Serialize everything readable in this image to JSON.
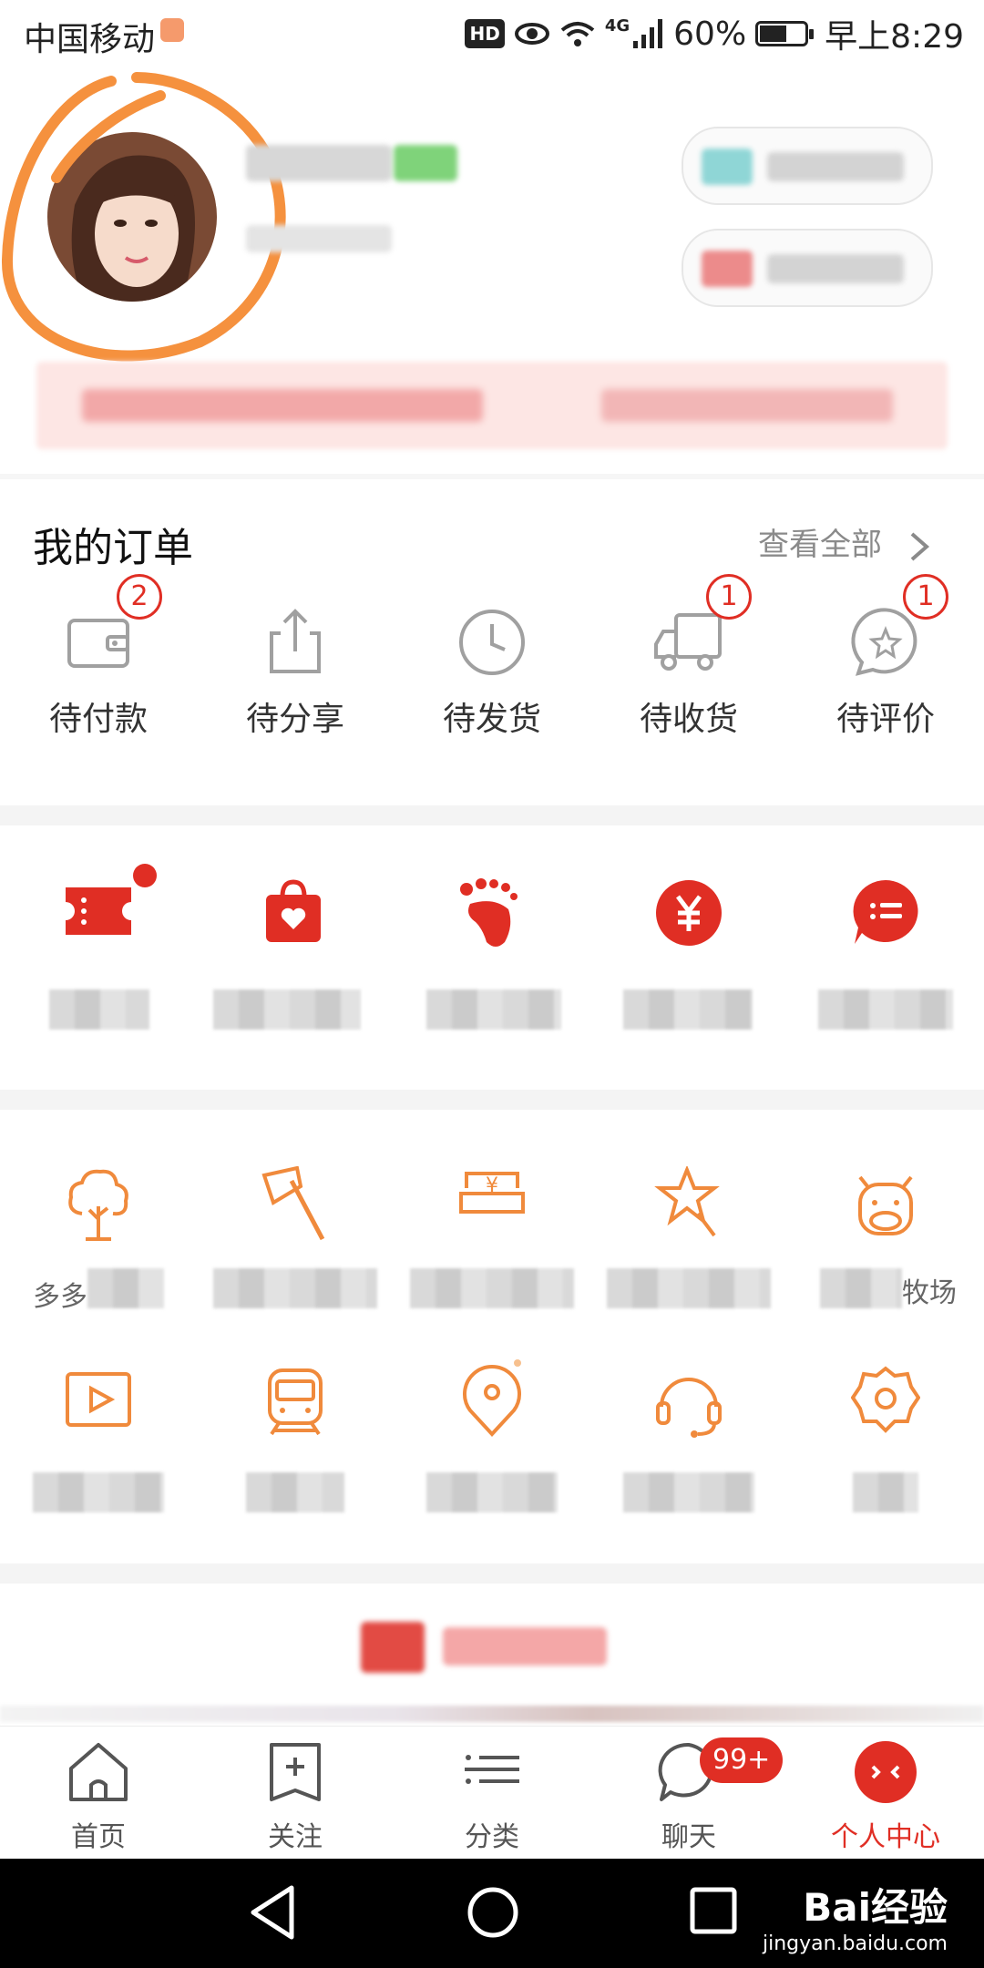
{
  "status_bar": {
    "carrier": "中国移动",
    "network": "4G",
    "hd_label": "HD",
    "battery": "60%",
    "time": "早上8:29"
  },
  "orders": {
    "title": "我的订单",
    "see_all": "查看全部",
    "items": [
      {
        "label": "待付款",
        "icon": "wallet-icon",
        "badge": "2"
      },
      {
        "label": "待分享",
        "icon": "share-icon",
        "badge": ""
      },
      {
        "label": "待发货",
        "icon": "clock-icon",
        "badge": ""
      },
      {
        "label": "待收货",
        "icon": "truck-icon",
        "badge": "1"
      },
      {
        "label": "待评价",
        "icon": "review-star-icon",
        "badge": "1"
      }
    ]
  },
  "services_row1": {
    "icons": [
      "coupon-icon",
      "favorites-bag-icon",
      "footprint-icon",
      "wallet-yuan-icon",
      "reviews-chat-icon"
    ]
  },
  "services_row2": {
    "icons": [
      "tree-icon",
      "axe-icon",
      "yuan-card-icon",
      "star-wand-icon",
      "cow-icon"
    ],
    "visible_text": [
      "多多",
      "",
      "",
      "",
      "牧场"
    ]
  },
  "services_row3": {
    "icons": [
      "video-play-icon",
      "train-icon",
      "location-pin-icon",
      "headset-icon",
      "settings-gear-icon"
    ]
  },
  "tabbar": {
    "tabs": [
      {
        "label": "首页",
        "icon": "home-icon"
      },
      {
        "label": "关注",
        "icon": "follow-plus-icon"
      },
      {
        "label": "分类",
        "icon": "category-list-icon"
      },
      {
        "label": "聊天",
        "icon": "chat-icon"
      },
      {
        "label": "个人中心",
        "icon": "profile-face-icon"
      }
    ],
    "chat_badge": "99+"
  },
  "watermark": {
    "brand": "Bai经验",
    "url": "jingyan.baidu.com"
  },
  "colors": {
    "accent_red": "#e02e24",
    "icon_orange": "#f08a3c",
    "annotation_orange": "#f5913e"
  }
}
